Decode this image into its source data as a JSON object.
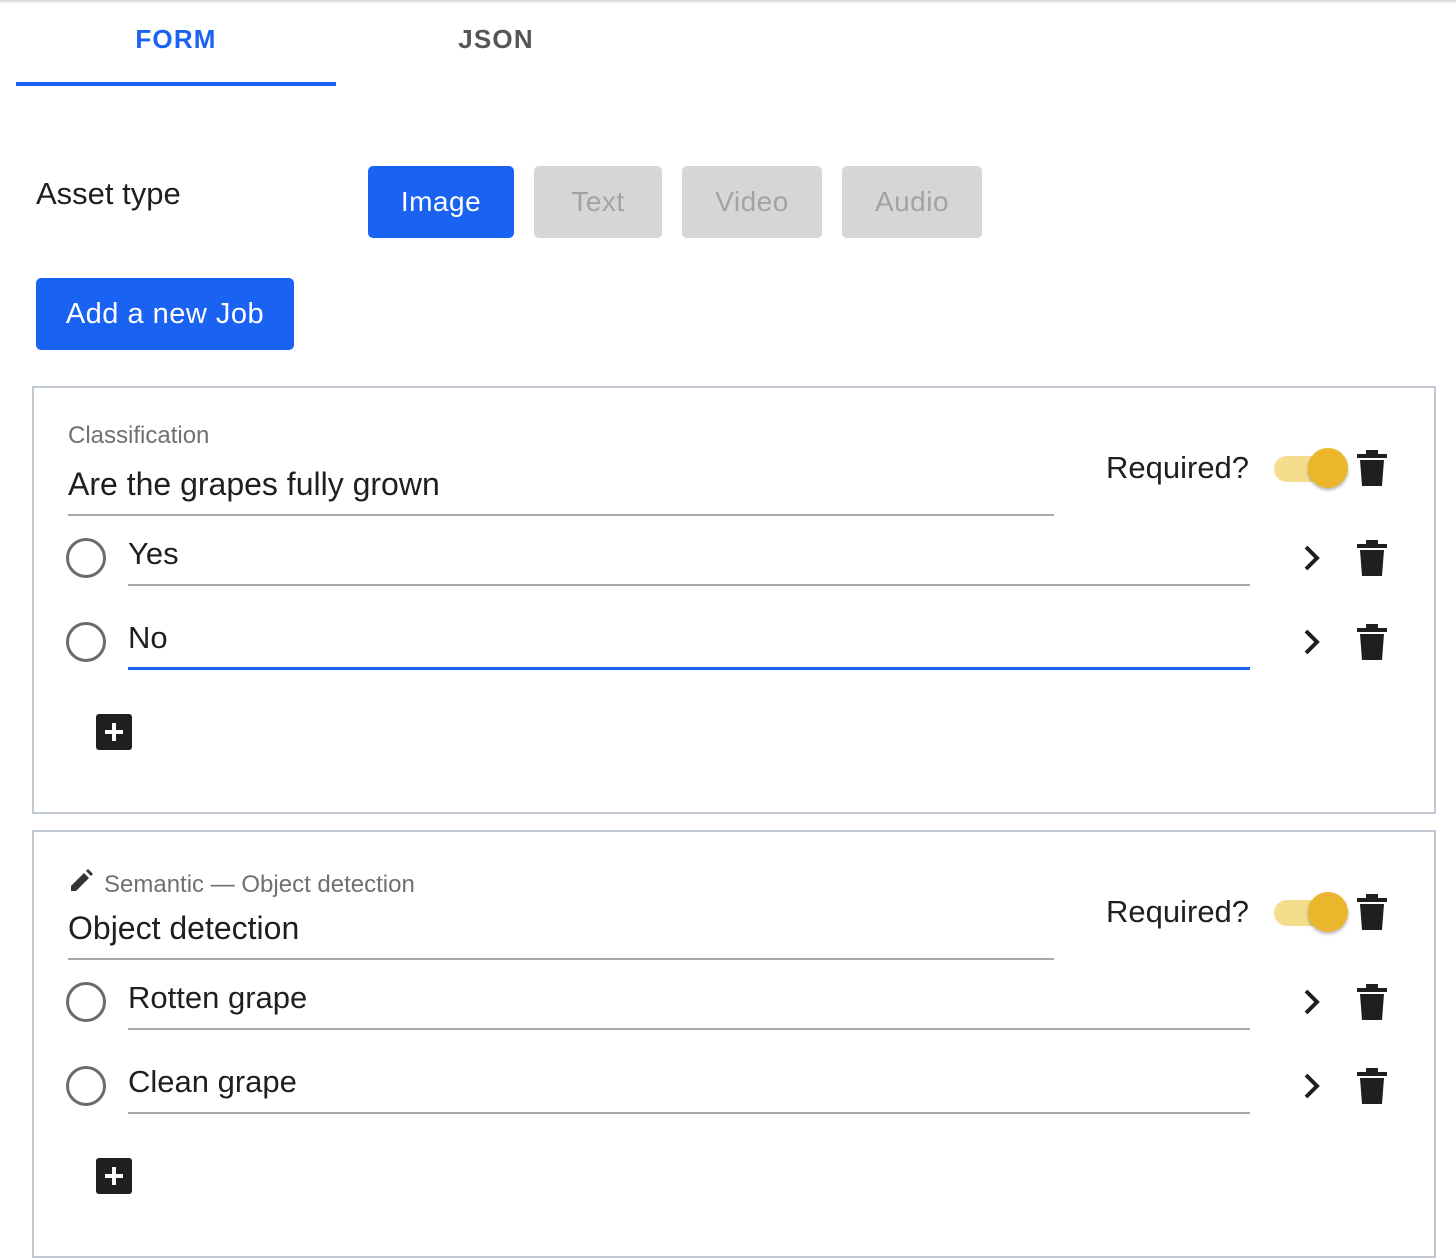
{
  "tabs": [
    {
      "label": "FORM",
      "active": true
    },
    {
      "label": "JSON",
      "active": false
    }
  ],
  "asset_type": {
    "label": "Asset type",
    "options": [
      "Image",
      "Text",
      "Video",
      "Audio"
    ],
    "selected": "Image"
  },
  "add_job_label": "Add a new Job",
  "jobs": [
    {
      "kind": "Classification",
      "title": "Are the grapes fully grown",
      "required_label": "Required?",
      "required": true,
      "options": [
        "Yes",
        "No"
      ],
      "focused_option": "No"
    },
    {
      "kind": "Semantic — Object detection",
      "title": "Object detection",
      "required_label": "Required?",
      "required": true,
      "options": [
        "Rotten grape",
        "Clean grape"
      ]
    }
  ],
  "icons": {
    "delete": "trash-icon",
    "expand": "chevron-right-icon",
    "add": "plus-box-icon",
    "edit": "pencil-icon"
  },
  "colors": {
    "accent": "#1a62f2",
    "toggle_on": "#eab62c",
    "toggle_track": "#f4dd8c",
    "disabled_bg": "#d6d6d6"
  }
}
